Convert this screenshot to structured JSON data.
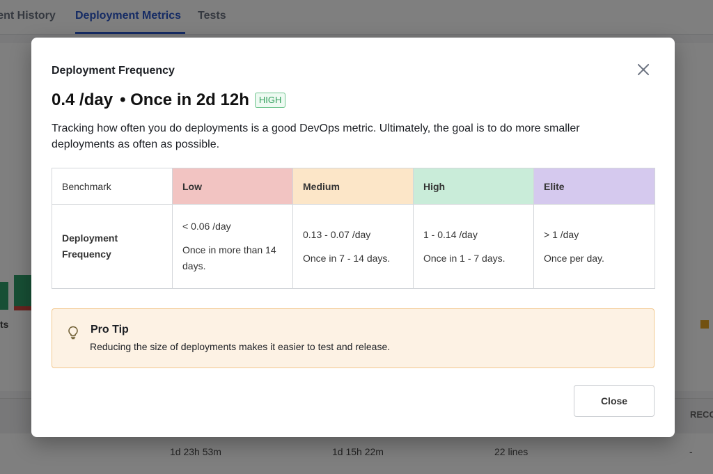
{
  "background": {
    "tabs": [
      "ment History",
      "Deployment Metrics",
      "Tests"
    ],
    "chart_label": "ts",
    "table_header_right": "RECO",
    "row_values": [
      "1d 23h 53m",
      "1d 15h 22m",
      "22 lines",
      "-"
    ]
  },
  "modal": {
    "title": "Deployment Frequency",
    "rate": "0.4 /day",
    "interval": "• Once in 2d 12h",
    "badge": "HIGH",
    "description": "Tracking how often you do deployments is a good DevOps metric. Ultimately, the goal is to do more smaller deployments as often as possible.",
    "table": {
      "headers": [
        "Benchmark",
        "Low",
        "Medium",
        "High",
        "Elite"
      ],
      "row_label": "Deployment Frequency",
      "cells": [
        {
          "rate": "< 0.06 /day",
          "text": "Once in more than 14 days."
        },
        {
          "rate": "0.13 - 0.07 /day",
          "text": "Once in 7 - 14 days."
        },
        {
          "rate": "1 - 0.14 /day",
          "text": "Once in 1 - 7 days."
        },
        {
          "rate": "> 1 /day",
          "text": "Once per day."
        }
      ]
    },
    "tip": {
      "icon": "lightbulb-icon",
      "title": "Pro Tip",
      "text": "Reducing the size of deployments makes it easier to test and release."
    },
    "close_label": "Close"
  },
  "colors": {
    "low": "#f2c4c2",
    "medium": "#fce6c8",
    "high": "#c9ecd9",
    "elite": "#d5c9ee",
    "badge": "#2f9e5a",
    "tip_bg": "#fdf2e4"
  }
}
